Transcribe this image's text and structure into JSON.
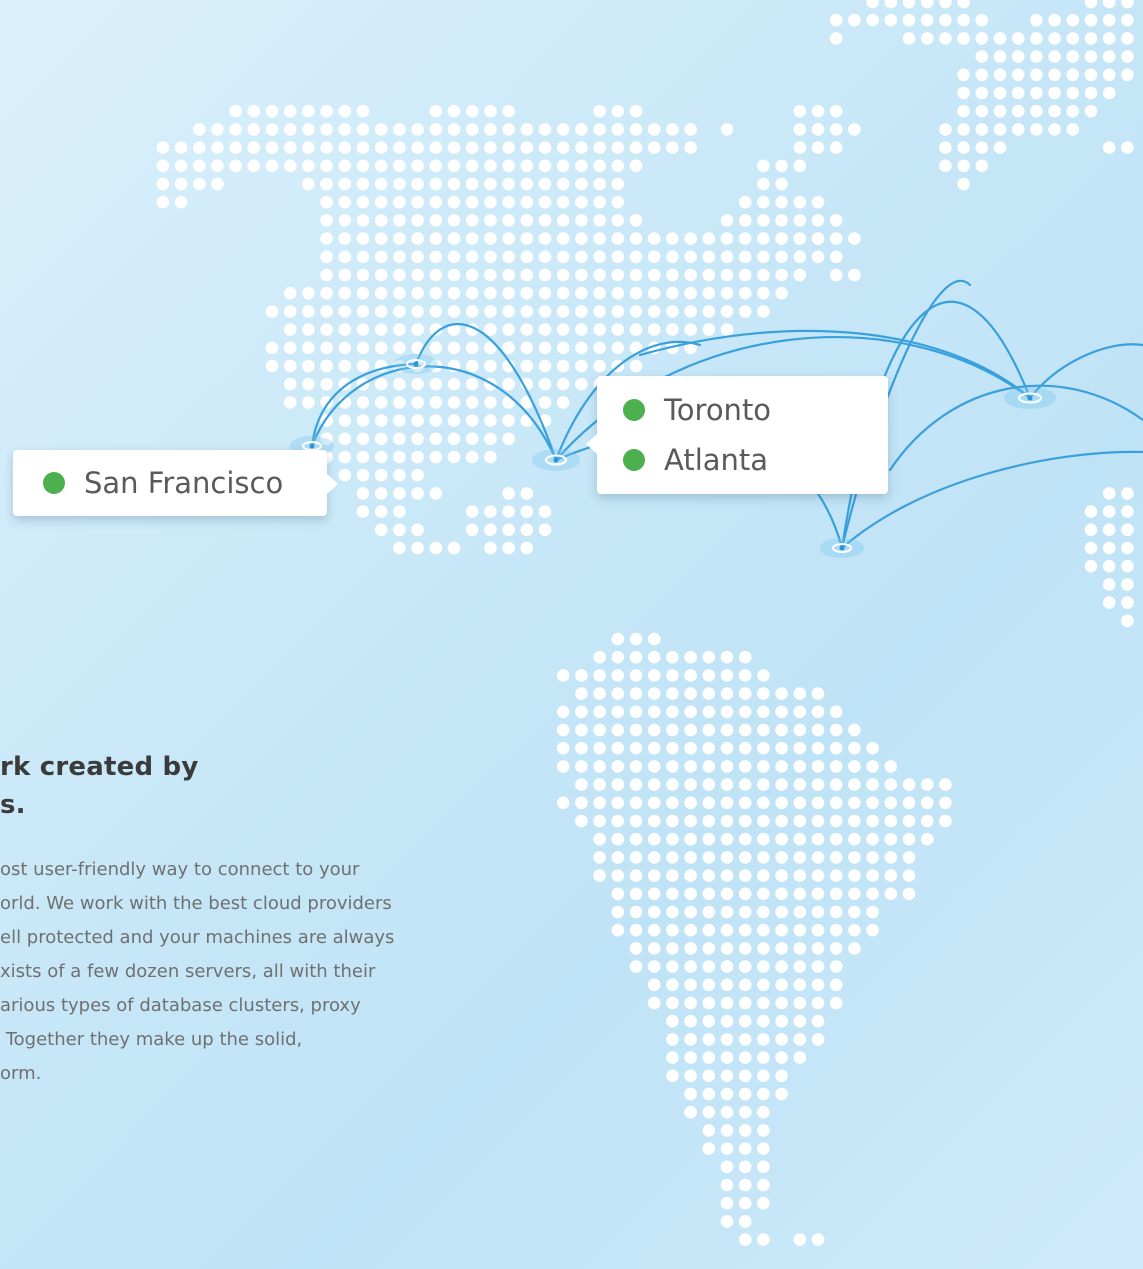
{
  "locations": {
    "san_francisco": "San Francisco",
    "toronto": "Toronto",
    "atlanta": "Atlanta"
  },
  "content": {
    "heading_lines": [
      "rk created by",
      "s."
    ],
    "body_lines": [
      "ost user-friendly way to connect to your",
      "orld. We work with the best cloud providers",
      "ell protected and your machines are always",
      "xists of a few dozen servers, all with their",
      "arious types of database clusters, proxy",
      " Together they make up the solid,",
      "orm."
    ]
  },
  "colors": {
    "status_online": "#4cb04f",
    "route_line": "#3aa0dc",
    "map_dots": "#ffffff"
  }
}
